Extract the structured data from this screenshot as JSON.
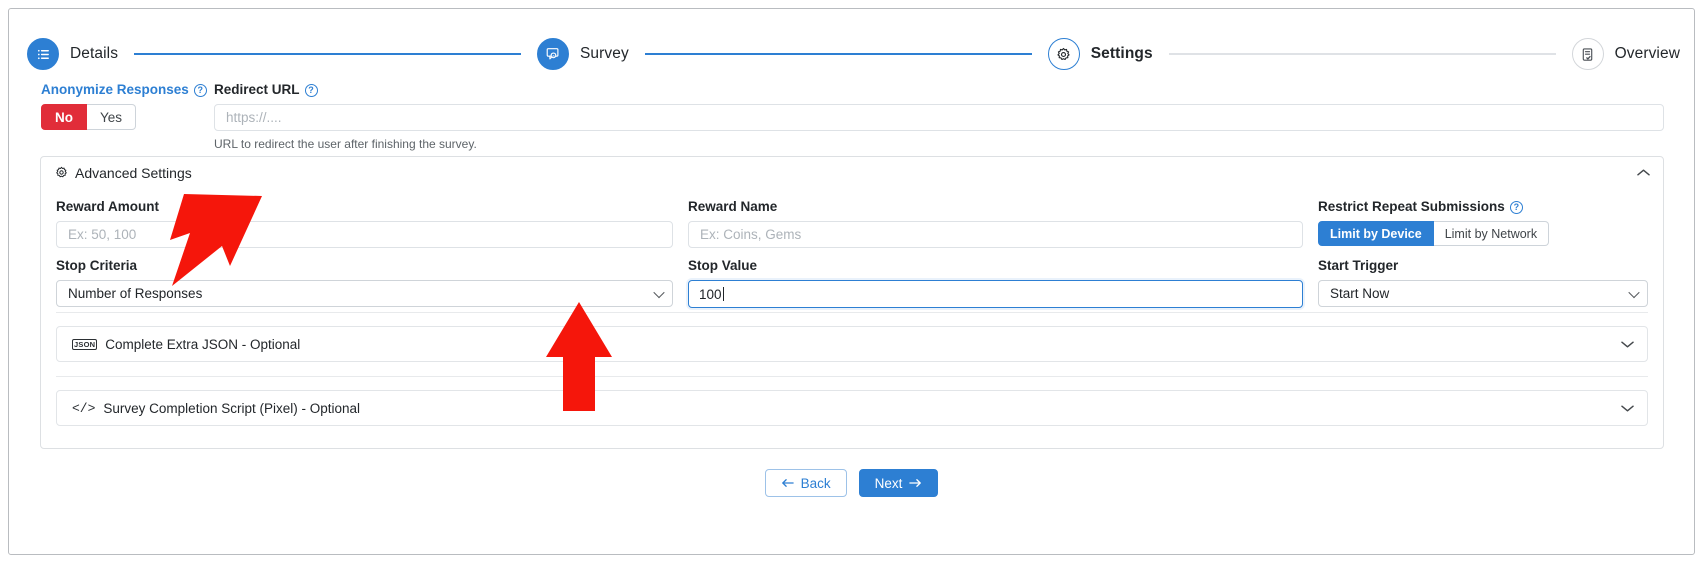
{
  "stepper": {
    "steps": [
      {
        "label": "Details",
        "icon": "list-icon",
        "state": "done"
      },
      {
        "label": "Survey",
        "icon": "survey-icon",
        "state": "done"
      },
      {
        "label": "Settings",
        "icon": "gear-icon",
        "state": "current"
      },
      {
        "label": "Overview",
        "icon": "report-icon",
        "state": "todo"
      }
    ]
  },
  "anonymize": {
    "label": "Anonymize Responses",
    "help_icon": "help-icon",
    "options": [
      "No",
      "Yes"
    ],
    "selected": "No"
  },
  "redirect": {
    "label": "Redirect URL",
    "help_icon": "help-icon",
    "value": "",
    "placeholder": "https://....",
    "hint": "URL to redirect the user after finishing the survey."
  },
  "advanced": {
    "title": "Advanced Settings",
    "icon": "gear-icon",
    "collapse_icon": "chevron-up-icon",
    "reward_amount": {
      "label": "Reward Amount",
      "value": "",
      "placeholder": "Ex: 50, 100"
    },
    "reward_name": {
      "label": "Reward Name",
      "value": "",
      "placeholder": "Ex: Coins, Gems"
    },
    "restrict_repeat": {
      "label": "Restrict Repeat Submissions",
      "help_icon": "help-icon",
      "options": [
        "Limit by Device",
        "Limit by Network"
      ],
      "selected": "Limit by Device"
    },
    "stop_criteria": {
      "label": "Stop Criteria",
      "value": "Number of Responses",
      "caret_icon": "chevron-down-icon"
    },
    "stop_value": {
      "label": "Stop Value",
      "value": "100",
      "focused": true
    },
    "start_trigger": {
      "label": "Start Trigger",
      "value": "Start Now",
      "caret_icon": "chevron-down-icon"
    },
    "extra_json": {
      "label": "Complete Extra JSON - Optional",
      "icon": "json-icon",
      "caret_icon": "chevron-down-icon"
    },
    "completion_script": {
      "label": "Survey Completion Script (Pixel) - Optional",
      "icon": "code-icon",
      "caret_icon": "chevron-down-icon"
    }
  },
  "footer": {
    "back_label": "Back",
    "back_icon": "arrow-left-icon",
    "next_label": "Next",
    "next_icon": "arrow-right-icon"
  },
  "annotations": {
    "arrow_color": "#f5160b",
    "arrow_stop_criteria": "diagonal-arrow-pointing-to-stop-criteria",
    "arrow_stop_value": "up-arrow-pointing-to-stop-value"
  },
  "colors": {
    "accent_blue": "#2d7fd3",
    "danger_red": "#e12d39",
    "annotation_red": "#f5160b"
  }
}
